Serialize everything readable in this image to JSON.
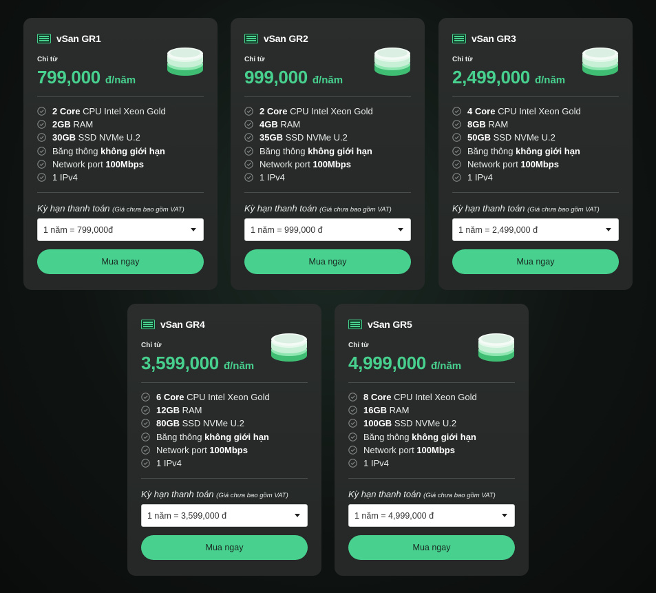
{
  "colors": {
    "accent": "#48d08f",
    "card_bg": "#2a2d2c",
    "page_bg": "#0f1412"
  },
  "icons": {
    "title": "server-icon",
    "hero": "storage-disks-icon",
    "feature": "check-circle-icon",
    "dropdown": "caret-down-icon"
  },
  "plans": [
    {
      "name": "vSan GR1",
      "from_label": "Chỉ từ",
      "price": "799,000",
      "unit": "đ/năm",
      "features": [
        {
          "bold": "2 Core",
          "text": " CPU Intel Xeon Gold"
        },
        {
          "bold": "2GB",
          "text": " RAM"
        },
        {
          "bold": "30GB",
          "text": " SSD NVMe U.2"
        },
        {
          "text": "Băng thông ",
          "bold2": "không giới hạn"
        },
        {
          "text": "Network port ",
          "bold2": "100Mbps"
        },
        {
          "text": "1 IPv4"
        }
      ],
      "term_label": "Kỳ hạn thanh toán",
      "term_note": "(Giá chưa bao gồm VAT)",
      "selected_term": "1 năm = 799,000đ",
      "buy_label": "Mua ngay"
    },
    {
      "name": "vSan GR2",
      "from_label": "Chỉ từ",
      "price": "999,000",
      "unit": "đ/năm",
      "features": [
        {
          "bold": "2 Core",
          "text": " CPU Intel Xeon Gold"
        },
        {
          "bold": "4GB",
          "text": " RAM"
        },
        {
          "bold": "35GB",
          "text": " SSD NVMe U.2"
        },
        {
          "text": "Băng thông ",
          "bold2": "không giới hạn"
        },
        {
          "text": "Network port ",
          "bold2": "100Mbps"
        },
        {
          "text": "1 IPv4"
        }
      ],
      "term_label": "Kỳ hạn thanh toán",
      "term_note": "(Giá chưa bao gồm VAT)",
      "selected_term": "1 năm = 999,000 đ",
      "buy_label": "Mua ngay"
    },
    {
      "name": "vSan GR3",
      "from_label": "Chỉ từ",
      "price": "2,499,000",
      "unit": "đ/năm",
      "features": [
        {
          "bold": "4 Core",
          "text": " CPU Intel Xeon Gold"
        },
        {
          "bold": "8GB",
          "text": " RAM"
        },
        {
          "bold": "50GB",
          "text": " SSD NVMe U.2"
        },
        {
          "text": "Băng thông ",
          "bold2": "không giới hạn"
        },
        {
          "text": "Network port ",
          "bold2": "100Mbps"
        },
        {
          "text": "1 IPv4"
        }
      ],
      "term_label": "Kỳ hạn thanh toán",
      "term_note": "(Giá chưa bao gồm VAT)",
      "selected_term": "1 năm = 2,499,000 đ",
      "buy_label": "Mua ngay"
    },
    {
      "name": "vSan GR4",
      "from_label": "Chỉ từ",
      "price": "3,599,000",
      "unit": "đ/năm",
      "features": [
        {
          "bold": "6 Core",
          "text": " CPU Intel Xeon Gold"
        },
        {
          "bold": "12GB",
          "text": " RAM"
        },
        {
          "bold": "80GB",
          "text": " SSD NVMe U.2"
        },
        {
          "text": "Băng thông ",
          "bold2": "không giới hạn"
        },
        {
          "text": "Network port ",
          "bold2": "100Mbps"
        },
        {
          "text": "1 IPv4"
        }
      ],
      "term_label": "Kỳ hạn thanh toán",
      "term_note": "(Giá chưa bao gồm VAT)",
      "selected_term": "1 năm = 3,599,000 đ",
      "buy_label": "Mua ngay"
    },
    {
      "name": "vSan GR5",
      "from_label": "Chỉ từ",
      "price": "4,999,000",
      "unit": "đ/năm",
      "features": [
        {
          "bold": "8 Core",
          "text": " CPU Intel Xeon Gold"
        },
        {
          "bold": "16GB",
          "text": " RAM"
        },
        {
          "bold": "100GB",
          "text": " SSD NVMe U.2"
        },
        {
          "text": "Băng thông ",
          "bold2": "không giới hạn"
        },
        {
          "text": "Network port ",
          "bold2": "100Mbps"
        },
        {
          "text": "1 IPv4"
        }
      ],
      "term_label": "Kỳ hạn thanh toán",
      "term_note": "(Giá chưa bao gồm VAT)",
      "selected_term": "1 năm = 4,999,000 đ",
      "buy_label": "Mua ngay"
    }
  ]
}
